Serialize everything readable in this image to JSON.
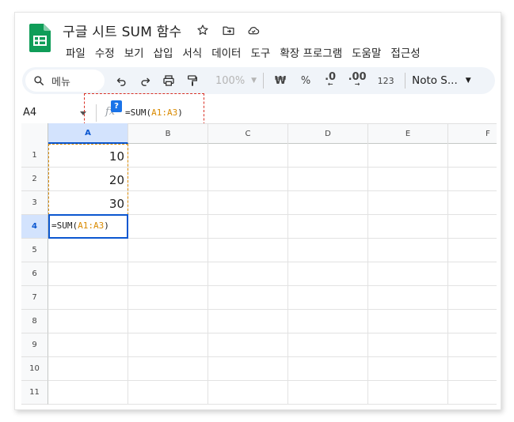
{
  "app": {
    "title": "구글 시트 SUM 함수",
    "logo_icon": "sheets-logo",
    "title_icons": [
      "star-icon",
      "move-folder-icon",
      "cloud-status-icon"
    ]
  },
  "menubar": [
    "파일",
    "수정",
    "보기",
    "삽입",
    "서식",
    "데이터",
    "도구",
    "확장 프로그램",
    "도움말",
    "접근성"
  ],
  "toolbar": {
    "search_label": "메뉴",
    "zoom": "100%",
    "currency": "₩",
    "percent": "%",
    "decrease_decimal": ".0",
    "increase_decimal": ".00",
    "number_format": "123",
    "font": "Noto S..."
  },
  "formula_bar": {
    "namebox": "A4",
    "help_badge": "?",
    "formula_prefix": "=SUM(",
    "formula_ref": "A1:A3",
    "formula_suffix": ")"
  },
  "sheet": {
    "columns": [
      "A",
      "B",
      "C",
      "D",
      "E",
      "F"
    ],
    "rows": [
      "1",
      "2",
      "3",
      "4",
      "5",
      "6",
      "7",
      "8",
      "9",
      "10",
      "11"
    ],
    "cells": {
      "A1": "10",
      "A2": "20",
      "A3": "30"
    },
    "active_cell": {
      "address": "A4",
      "text_prefix": "=SUM(",
      "text_ref": "A1:A3",
      "text_suffix": ")"
    }
  },
  "colors": {
    "accent": "#0b57d0",
    "reference": "#d98a00",
    "highlight_box": "#d93025",
    "logo_green": "#0f9d58"
  }
}
